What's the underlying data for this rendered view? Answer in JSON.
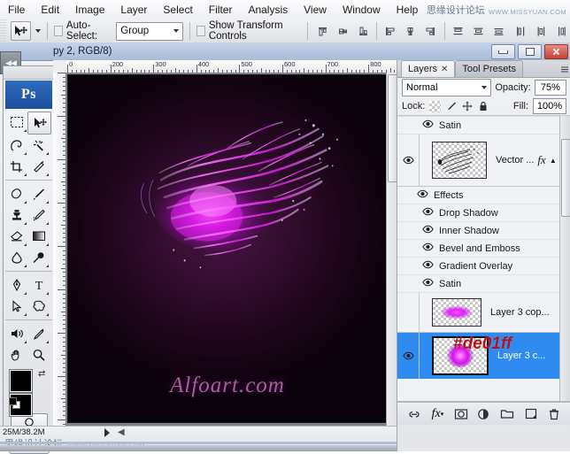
{
  "app": {
    "name": "Adobe Photoshop",
    "logo_text": "Ps"
  },
  "menubar": {
    "items": [
      {
        "label": "File"
      },
      {
        "label": "Edit"
      },
      {
        "label": "Image"
      },
      {
        "label": "Layer"
      },
      {
        "label": "Select"
      },
      {
        "label": "Filter"
      },
      {
        "label": "Analysis"
      },
      {
        "label": "View"
      },
      {
        "label": "Window"
      },
      {
        "label": "Help"
      }
    ],
    "watermark_cn": "思缘设计论坛",
    "watermark_en": "WWW.MISSYUAN.COM"
  },
  "options_bar": {
    "tool": "move-tool",
    "auto_select_label": "Auto-Select:",
    "auto_select_checked": false,
    "auto_select_value": "Group",
    "show_transform_label": "Show Transform Controls",
    "show_transform_checked": false,
    "align_icons": [
      "align-top-edges-icon",
      "align-vertical-centers-icon",
      "align-bottom-edges-icon",
      "align-left-edges-icon",
      "align-horizontal-centers-icon",
      "align-right-edges-icon",
      "distribute-top-edges-icon",
      "distribute-vertical-centers-icon",
      "distribute-bottom-edges-icon",
      "distribute-left-edges-icon",
      "distribute-horizontal-centers-icon",
      "distribute-right-edges-icon"
    ]
  },
  "document": {
    "title": "py 2, RGB/8)",
    "title_full_visible": "...py 2, RGB/8)",
    "ruler_units_h": [
      "0",
      "200",
      "300",
      "400",
      "500",
      "600",
      "700",
      "800"
    ],
    "artwork_caption": "Alfoart.com",
    "artwork_description": "magenta liquid splash on dark purple background"
  },
  "window_buttons": {
    "minimize": "minimize-button",
    "maximize": "maximize-button",
    "close": "close-button"
  },
  "toolbox": {
    "tools": [
      "rectangular-marquee-tool",
      "move-tool",
      "lasso-tool",
      "magic-wand-tool",
      "crop-tool",
      "slice-tool",
      "healing-brush-tool",
      "brush-tool",
      "clone-stamp-tool",
      "history-brush-tool",
      "eraser-tool",
      "gradient-tool",
      "blur-tool",
      "dodge-tool",
      "pen-tool",
      "type-tool",
      "path-selection-tool",
      "custom-shape-tool",
      "audio-annotation-tool",
      "eyedropper-tool",
      "hand-tool",
      "zoom-tool"
    ],
    "foreground_color": "#000000",
    "background_color": "#000000",
    "quick_mask": "quick-mask-mode",
    "screen_mode": "screen-mode-button"
  },
  "panel": {
    "tabs": [
      {
        "label": "Layers",
        "active": true,
        "closable": true
      },
      {
        "label": "Tool Presets",
        "active": false,
        "closable": false
      }
    ],
    "blend_mode": "Normal",
    "opacity_label": "Opacity:",
    "opacity_value": "75%",
    "lock_label": "Lock:",
    "lock_icons": [
      "lock-transparent-pixels-icon",
      "lock-image-pixels-icon",
      "lock-position-icon",
      "lock-all-icon"
    ],
    "fill_label": "Fill:",
    "fill_value": "100%",
    "annotation_hex": "#de01ff",
    "rows": [
      {
        "type": "effect",
        "name": "Satin",
        "visible": true
      },
      {
        "type": "layer",
        "name": "Vector ...",
        "visible": true,
        "has_fx": true,
        "thumb": "vector-splash-thumb",
        "selected": false
      },
      {
        "type": "group-header",
        "name": "Effects",
        "visible": true
      },
      {
        "type": "effect",
        "name": "Drop Shadow",
        "visible": true
      },
      {
        "type": "effect",
        "name": "Inner Shadow",
        "visible": true
      },
      {
        "type": "effect",
        "name": "Bevel and Emboss",
        "visible": true
      },
      {
        "type": "effect",
        "name": "Gradient Overlay",
        "visible": true
      },
      {
        "type": "effect",
        "name": "Satin",
        "visible": true
      },
      {
        "type": "layer",
        "name": "Layer 3 cop...",
        "visible": false,
        "has_fx": false,
        "thumb": "pink-glow-thumb",
        "selected": false
      },
      {
        "type": "layer",
        "name": "Layer 3 c...",
        "visible": true,
        "has_fx": false,
        "thumb": "pink-glow-thumb-large",
        "selected": true
      }
    ],
    "footer_buttons": [
      "link-layers-button",
      "add-layer-style-button",
      "add-layer-mask-button",
      "new-adjustment-layer-button",
      "new-group-button",
      "new-layer-button",
      "delete-layer-button"
    ]
  },
  "status_bar": {
    "doc_sizes": "25M/38.2M",
    "watermark_cn": "思缘设计论坛",
    "watermark_en": "WWW.MISSYUAN.COM"
  }
}
